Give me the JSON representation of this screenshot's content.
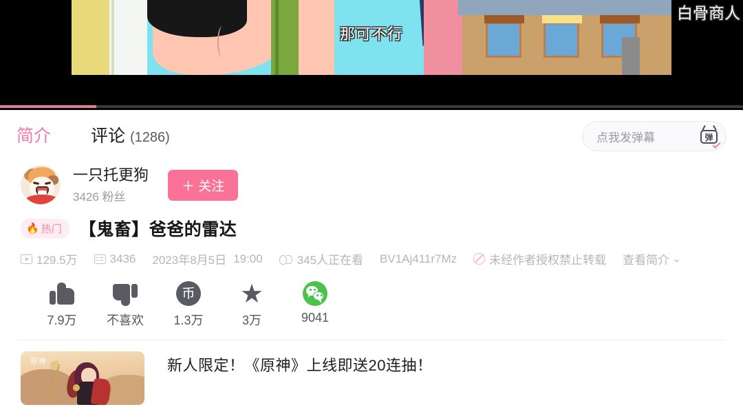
{
  "player": {
    "subtitle": "那可不行",
    "danmaku_overlay": "白骨商人",
    "progress_percent": 13,
    "progress_color": "#e07f9a"
  },
  "tabs": [
    {
      "label": "简介",
      "active": true
    },
    {
      "label": "评论",
      "count": "(1286)",
      "active": false
    }
  ],
  "danmaku_input": {
    "placeholder": "点我发弹幕",
    "icon_label": "弹",
    "icon_name": "bilibili-danmaku-tv-icon"
  },
  "uploader": {
    "name": "一只托更狗",
    "fans": "3426 粉丝",
    "follow_label": "＋ 关注",
    "follow_color": "#fb7299",
    "avatar_name": "uploader-avatar"
  },
  "video": {
    "hot_badge": "热门",
    "flame_icon": "🔥",
    "title": "【鬼畜】爸爸的雷达",
    "meta": {
      "views": "129.5万",
      "danmaku": "3436",
      "date": "2023年8月5日",
      "time": "19:00",
      "watching": "345人正在看",
      "bvid": "BV1Aj411r7Mz",
      "copyright": "未经作者授权禁止转载",
      "expand_label": "查看简介",
      "expand_chevron": "⌄"
    }
  },
  "actions": [
    {
      "name": "like",
      "icon": "thumb-up-icon",
      "label": "7.9万"
    },
    {
      "name": "dislike",
      "icon": "thumb-down-icon",
      "label": "不喜欢"
    },
    {
      "name": "coin",
      "icon": "coin-icon",
      "glyph": "币",
      "label": "1.3万"
    },
    {
      "name": "favorite",
      "icon": "star-icon",
      "glyph": "★",
      "label": "3万"
    },
    {
      "name": "share-wechat",
      "icon": "wechat-icon",
      "label": "9041",
      "color": "#4bc34b"
    }
  ],
  "ad": {
    "text": "新人限定！《原神》上线即送20连抽！",
    "thumb_logo": "原神",
    "thumb_name": "genshin-ad-thumbnail"
  }
}
